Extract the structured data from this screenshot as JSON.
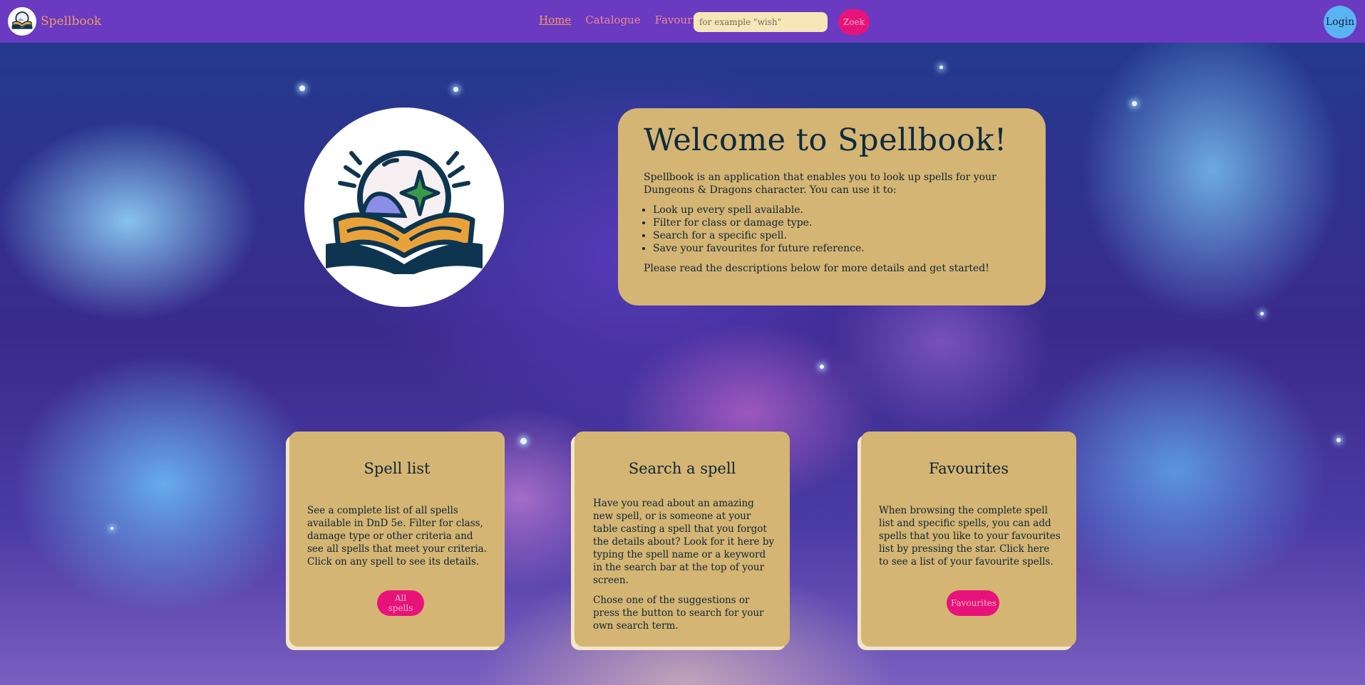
{
  "nav": {
    "brand": "Spellbook",
    "links": [
      "Home",
      "Catalogue",
      "Favourites"
    ],
    "search_placeholder": "for example \"wish\"",
    "search_button": "Zoek",
    "login_button": "Login"
  },
  "welcome": {
    "title": "Welcome to Spellbook!",
    "intro": "Spellbook is an application that enables you to look up spells for your Dungeons & Dragons character. You can use it to:",
    "bullets": [
      "Look up every spell available.",
      "Filter for class or damage type.",
      "Search for a specific spell.",
      "Save your favourites for future reference."
    ],
    "outro": "Please read the descriptions below for more details and get started!"
  },
  "cards": [
    {
      "title": "Spell list",
      "paragraphs": [
        "See a complete list of all spells available in DnD 5e. Filter for class, damage type or other criteria and see all spells that meet your criteria. Click on any spell to see its details."
      ],
      "button": "All spells"
    },
    {
      "title": "Search a spell",
      "paragraphs": [
        "Have you read about an amazing new spell, or is someone at your table casting a spell that you forgot the details about? Look for it here by typing the spell name or a keyword in the search bar at the top of your screen.",
        "Chose one of the suggestions or press the button to search for your own search term."
      ],
      "button": ""
    },
    {
      "title": "Favourites",
      "paragraphs": [
        "When browsing the complete spell list and specific spells, you can add spells that you like to your favourites list by pressing the star. Click here to see a list of your favourite spells."
      ],
      "button": "Favourites"
    }
  ],
  "icons": [
    "spellbook-logo-icon",
    "crystal-ball-book-icon"
  ],
  "colors": {
    "topbar": "#6a3ac0",
    "panel": "#d4b573",
    "accent_button": "#e8137a",
    "login_button": "#5ab3f2",
    "brand_text": "#f29a66",
    "nav_link": "#f08a8f",
    "search_bg": "#f6e6b8"
  }
}
